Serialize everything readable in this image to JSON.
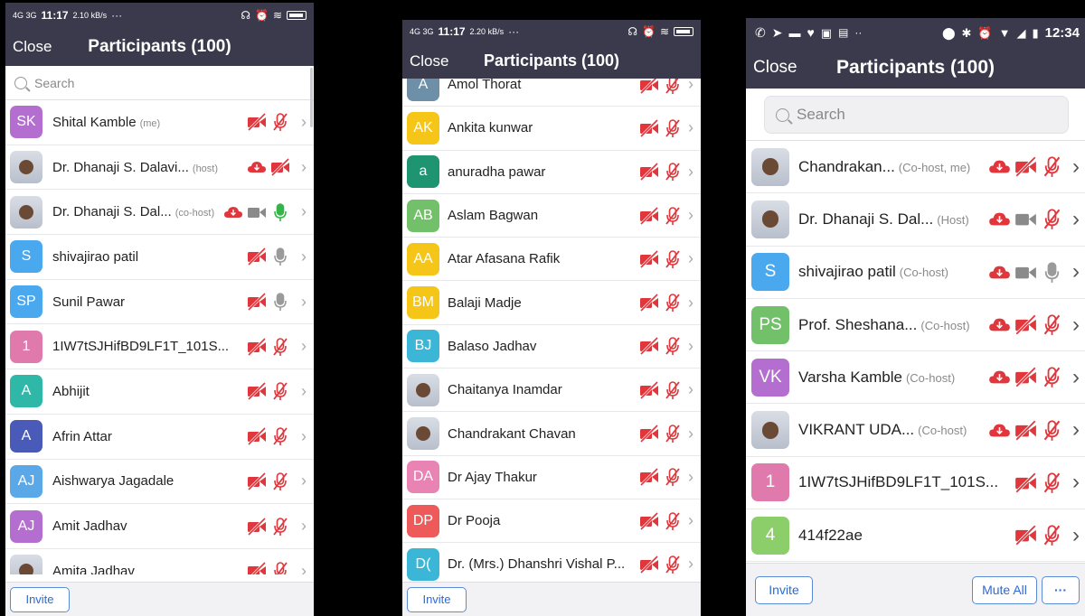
{
  "colors": {
    "bar": "#3a3a4c",
    "red": "#e0363c",
    "green": "#35b44a",
    "accent": "#2b6ad6"
  },
  "p1": {
    "status": {
      "signal": "4G 3G",
      "time": "11:17",
      "speed": "2.10 kB/s",
      "dots": "···",
      "battery": "88"
    },
    "close": "Close",
    "title": "Participants (100)",
    "search_placeholder": "Search",
    "rows": [
      {
        "initials": "SK",
        "color": "#b46ed0",
        "name": "Shital Kamble",
        "tag": "(me)",
        "icons": [
          "video-off",
          "mic-muted"
        ]
      },
      {
        "photo": true,
        "name": "Dr. Dhanaji S. Dalavi...",
        "tag": "(host)",
        "icons": [
          "cloud",
          "video-off"
        ]
      },
      {
        "photo": true,
        "name": "Dr. Dhanaji S. Dal...",
        "tag": "(co-host)",
        "icons": [
          "cloud",
          "video-grey",
          "mic-green"
        ]
      },
      {
        "initials": "S",
        "color": "#4aa8ee",
        "name": "shivajirao  patil",
        "tag": "",
        "icons": [
          "video-off",
          "mic-grey"
        ]
      },
      {
        "initials": "SP",
        "color": "#4aa8ee",
        "name": "Sunil Pawar",
        "tag": "",
        "icons": [
          "video-off",
          "mic-grey"
        ]
      },
      {
        "initials": "1",
        "color": "#e07aac",
        "name": "1IW7tSJHifBD9LF1T_101S...",
        "tag": "",
        "icons": [
          "video-off",
          "mic-muted"
        ]
      },
      {
        "initials": "A",
        "color": "#2fb8a8",
        "name": "Abhijit",
        "tag": "",
        "icons": [
          "video-off",
          "mic-muted"
        ]
      },
      {
        "initials": "A",
        "color": "#4a5ab8",
        "name": "Afrin Attar",
        "tag": "",
        "icons": [
          "video-off",
          "mic-muted"
        ]
      },
      {
        "initials": "AJ",
        "color": "#5aa8e8",
        "name": "Aishwarya Jagadale",
        "tag": "",
        "icons": [
          "video-off",
          "mic-muted"
        ]
      },
      {
        "initials": "AJ",
        "color": "#b46ed0",
        "name": "Amit Jadhav",
        "tag": "",
        "icons": [
          "video-off",
          "mic-muted"
        ]
      },
      {
        "photo": true,
        "name": "Amita Jadhav",
        "tag": "",
        "icons": [
          "video-off",
          "mic-muted"
        ]
      }
    ],
    "invite": "Invite"
  },
  "p2": {
    "status": {
      "signal": "4G 3G",
      "time": "11:17",
      "speed": "2.20 kB/s",
      "dots": "···",
      "battery": "88"
    },
    "close": "Close",
    "title": "Participants (100)",
    "rows": [
      {
        "initials": "A",
        "color": "#6d8fa8",
        "name": "Amol Thorat",
        "icons": [
          "video-off",
          "mic-muted"
        ]
      },
      {
        "initials": "AK",
        "color": "#f5c518",
        "name": "Ankita kunwar",
        "icons": [
          "video-off",
          "mic-muted"
        ]
      },
      {
        "initials": "a",
        "color": "#1e9470",
        "name": "anuradha pawar",
        "icons": [
          "video-off",
          "mic-muted"
        ]
      },
      {
        "initials": "AB",
        "color": "#72c06a",
        "name": "Aslam Bagwan",
        "icons": [
          "video-off",
          "mic-muted"
        ]
      },
      {
        "initials": "AA",
        "color": "#f5c518",
        "name": "Atar Afasana Rafik",
        "icons": [
          "video-off",
          "mic-muted"
        ]
      },
      {
        "initials": "BM",
        "color": "#f5c518",
        "name": "Balaji Madje",
        "icons": [
          "video-off",
          "mic-muted"
        ]
      },
      {
        "initials": "BJ",
        "color": "#3cb6d6",
        "name": "Balaso Jadhav",
        "icons": [
          "video-off",
          "mic-muted"
        ]
      },
      {
        "photo": true,
        "name": "Chaitanya Inamdar",
        "icons": [
          "video-off",
          "mic-muted"
        ]
      },
      {
        "photo": true,
        "name": "Chandrakant Chavan",
        "icons": [
          "video-off",
          "mic-muted"
        ]
      },
      {
        "initials": "DA",
        "color": "#e883b3",
        "name": "Dr Ajay Thakur",
        "icons": [
          "video-off",
          "mic-muted"
        ]
      },
      {
        "initials": "DP",
        "color": "#ee5a5a",
        "name": "Dr Pooja",
        "icons": [
          "video-off",
          "mic-muted"
        ]
      },
      {
        "initials": "D(",
        "color": "#3cb6d6",
        "name": "Dr. (Mrs.) Dhanshri Vishal P...",
        "icons": [
          "video-off",
          "mic-muted"
        ]
      }
    ],
    "invite": "Invite"
  },
  "p3": {
    "status": {
      "time": "12:34"
    },
    "close": "Close",
    "title": "Participants (100)",
    "search_placeholder": "Search",
    "rows": [
      {
        "photo": true,
        "name": "Chandrakan...",
        "tag": "(Co-host, me)",
        "icons": [
          "cloud",
          "video-off",
          "mic-muted"
        ]
      },
      {
        "photo": true,
        "name": "Dr. Dhanaji S. Dal...",
        "tag": "(Host)",
        "icons": [
          "cloud",
          "video-grey",
          "mic-muted"
        ]
      },
      {
        "initials": "S",
        "color": "#4aa8ee",
        "name": "shivajirao  patil",
        "tag": "(Co-host)",
        "icons": [
          "cloud",
          "video-grey",
          "mic-grey"
        ]
      },
      {
        "initials": "PS",
        "color": "#72c06a",
        "name": "Prof. Sheshana...",
        "tag": "(Co-host)",
        "icons": [
          "cloud",
          "video-off",
          "mic-muted"
        ]
      },
      {
        "initials": "VK",
        "color": "#b46ed0",
        "name": "Varsha Kamble",
        "tag": "(Co-host)",
        "icons": [
          "cloud",
          "video-off",
          "mic-muted"
        ]
      },
      {
        "photo": true,
        "name": "VIKRANT UDA...",
        "tag": "(Co-host)",
        "icons": [
          "cloud",
          "video-off",
          "mic-muted"
        ]
      },
      {
        "initials": "1",
        "color": "#e07aac",
        "name": "1IW7tSJHifBD9LF1T_101S...",
        "tag": "",
        "icons": [
          "video-off",
          "mic-muted"
        ]
      },
      {
        "initials": "4",
        "color": "#8ccf6a",
        "name": "414f22ae",
        "tag": "",
        "icons": [
          "video-off",
          "mic-muted"
        ]
      }
    ],
    "invite": "Invite",
    "mute_all": "Mute All",
    "more": "···"
  }
}
